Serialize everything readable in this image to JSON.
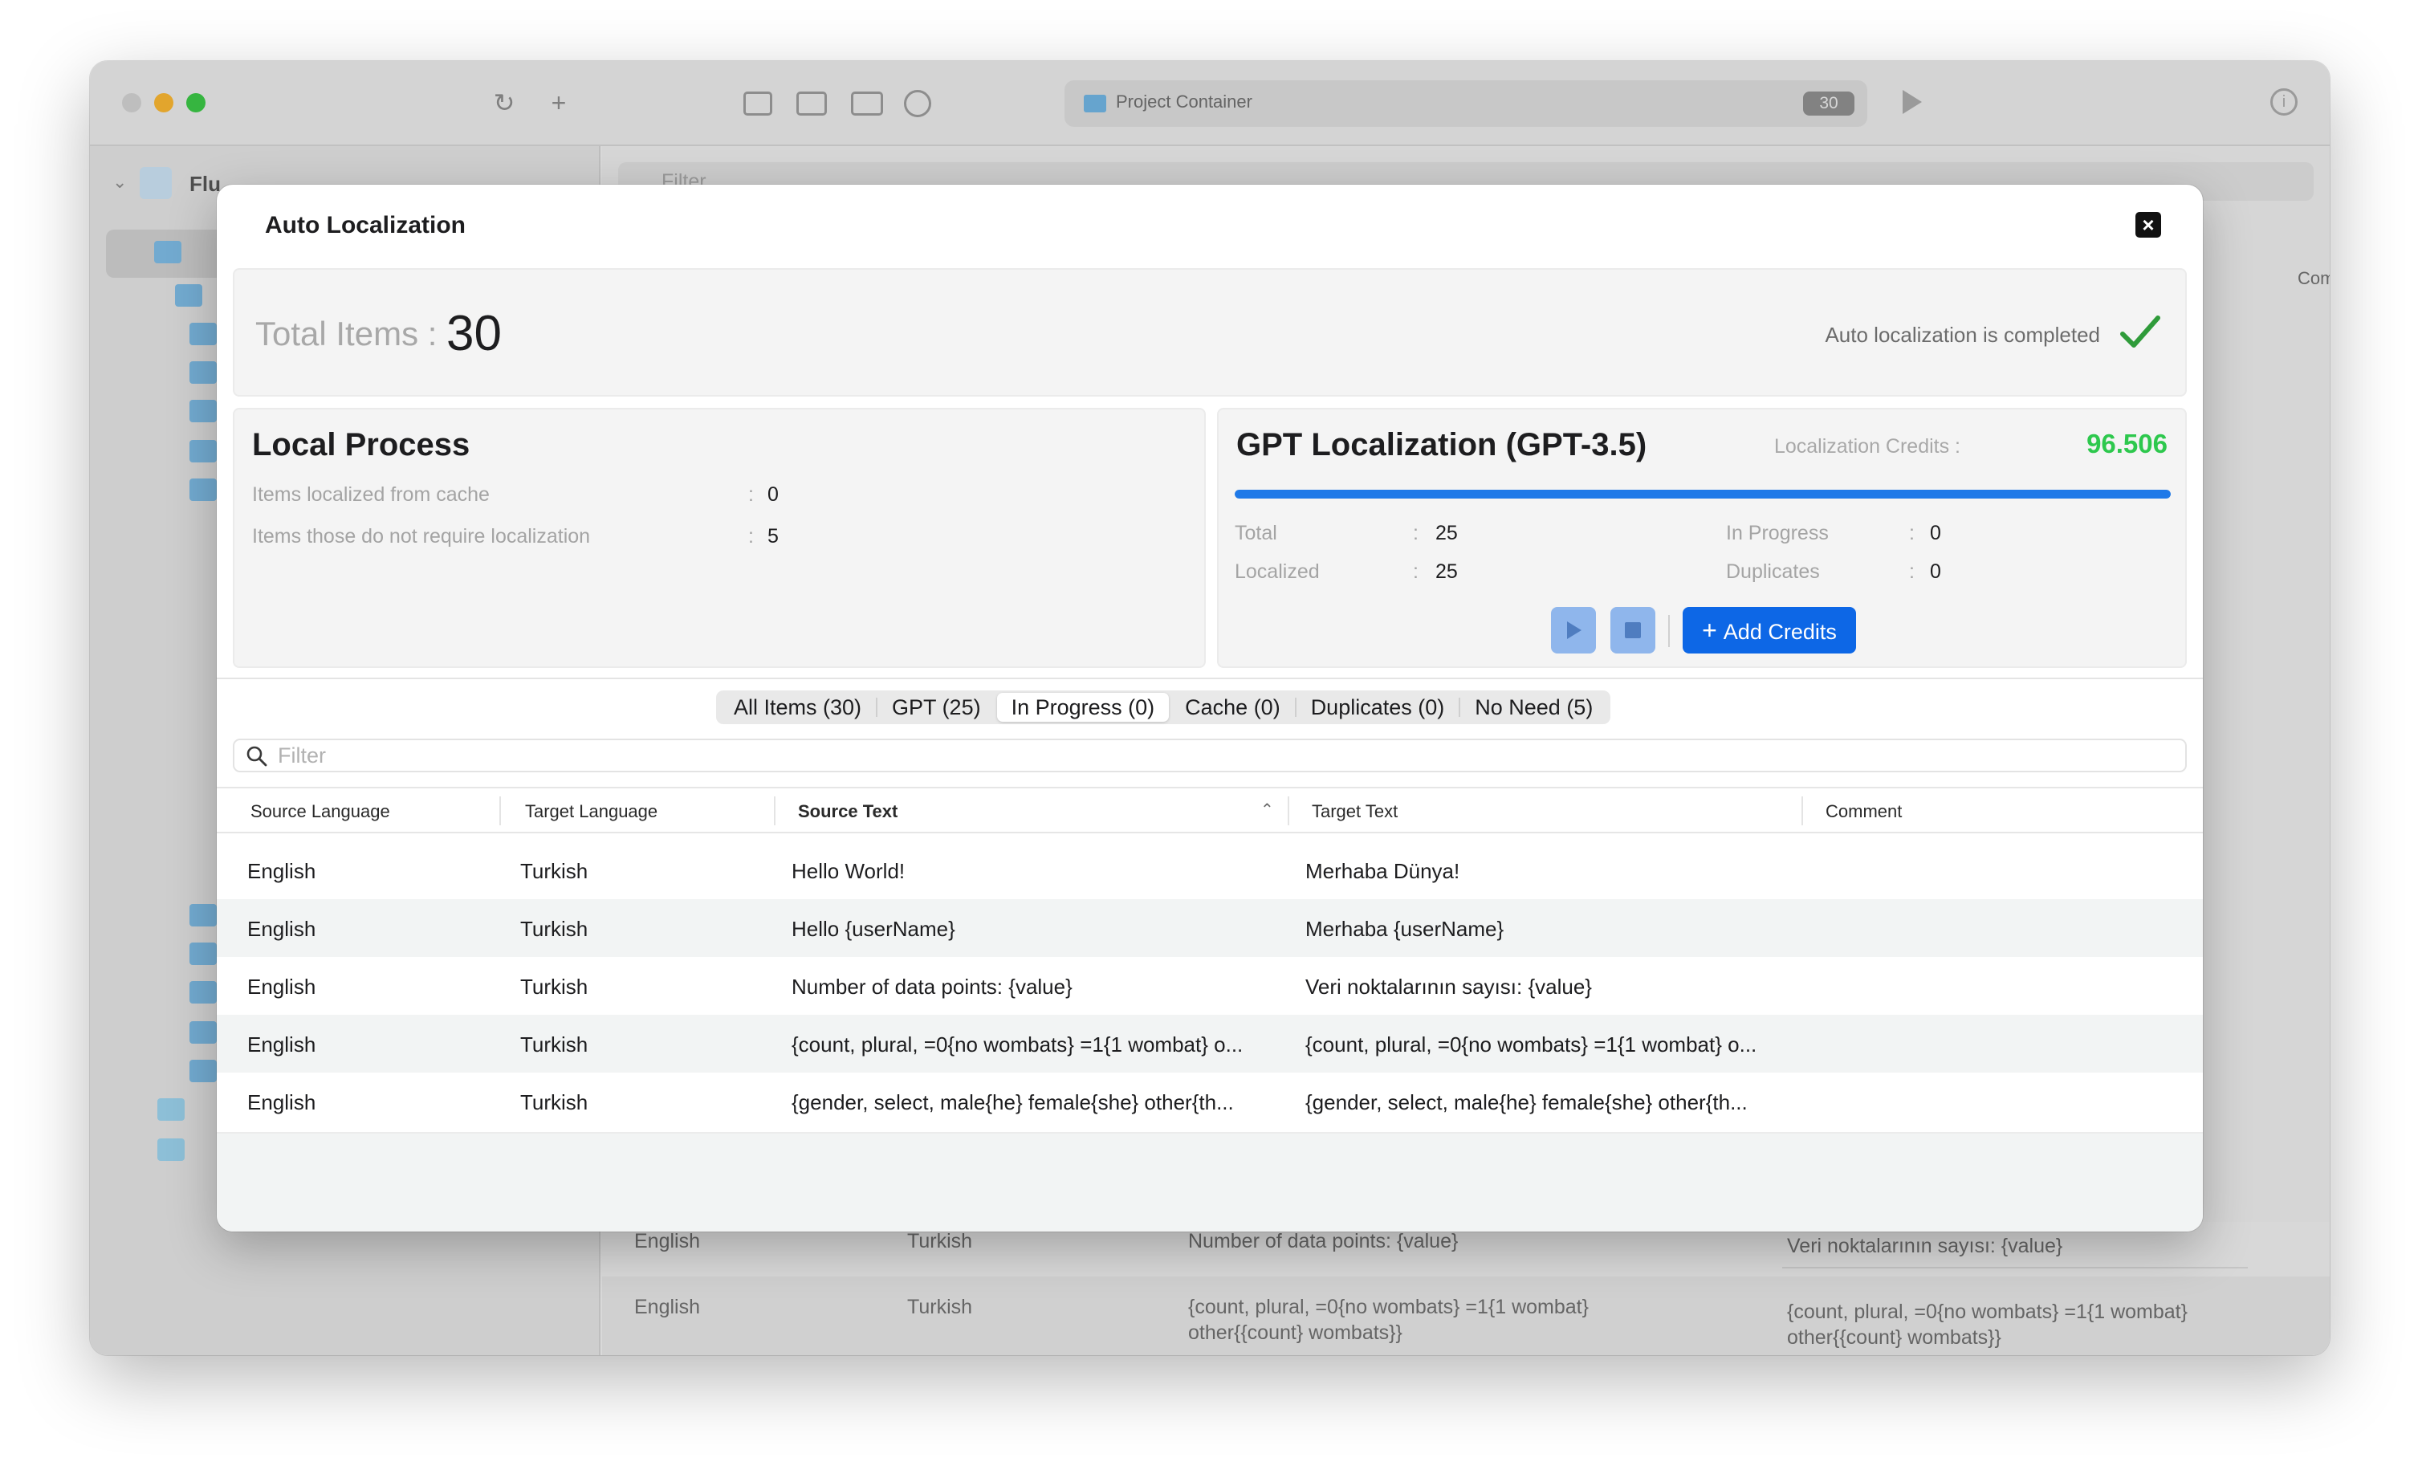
{
  "window": {
    "path_bar": {
      "label": "Project Container",
      "count": "30"
    },
    "sidebar_project": "Flu",
    "background_column_comment": "Comment",
    "background_filter_placeholder": "Filter",
    "background_rows": [
      {
        "source_language": "English",
        "target_language": "Turkish",
        "source_text": "Number of data points: {value}",
        "target_text": "Veri noktalarının sayısı: {value}"
      },
      {
        "source_language": "English",
        "target_language": "Turkish",
        "source_text_line1": "{count, plural, =0{no wombats} =1{1 wombat}",
        "source_text_line2": "other{{count} wombats}}",
        "target_text_line1": "{count, plural, =0{no wombats} =1{1 wombat}",
        "target_text_line2": "other{{count} wombats}}"
      }
    ]
  },
  "modal": {
    "title": "Auto Localization",
    "summary": {
      "total_label": "Total Items :",
      "total_value": "30",
      "status_text": "Auto localization is completed"
    },
    "local_process": {
      "title": "Local Process",
      "items": [
        {
          "label": "Items localized from cache",
          "value": "0"
        },
        {
          "label": "Items those do not require localization",
          "value": "5"
        }
      ]
    },
    "gpt": {
      "title": "GPT Localization (GPT-3.5)",
      "credits_label": "Localization Credits :",
      "credits_value": "96.506",
      "progress": 1.0,
      "stats_left": [
        {
          "label": "Total",
          "value": "25"
        },
        {
          "label": "Localized",
          "value": "25"
        }
      ],
      "stats_right": [
        {
          "label": "In Progress",
          "value": "0"
        },
        {
          "label": "Duplicates",
          "value": "0"
        }
      ],
      "add_credits_label": "Add Credits"
    },
    "tabs": [
      {
        "label": "All Items (30)",
        "active": false
      },
      {
        "label": "GPT (25)",
        "active": false
      },
      {
        "label": "In Progress (0)",
        "active": true
      },
      {
        "label": "Cache (0)",
        "active": false
      },
      {
        "label": "Duplicates (0)",
        "active": false
      },
      {
        "label": "No Need (5)",
        "active": false
      }
    ],
    "filter_placeholder": "Filter",
    "columns": [
      "Source Language",
      "Target Language",
      "Source Text",
      "Target Text",
      "Comment"
    ],
    "rows": [
      {
        "source_language": "English",
        "target_language": "Turkish",
        "source_text": "Hello World!",
        "target_text": "Merhaba Dünya!",
        "comment": ""
      },
      {
        "source_language": "English",
        "target_language": "Turkish",
        "source_text": "Hello {userName}",
        "target_text": "Merhaba {userName}",
        "comment": ""
      },
      {
        "source_language": "English",
        "target_language": "Turkish",
        "source_text": "Number of data points: {value}",
        "target_text": "Veri noktalarının sayısı: {value}",
        "comment": ""
      },
      {
        "source_language": "English",
        "target_language": "Turkish",
        "source_text": "{count, plural, =0{no wombats} =1{1 wombat} o...",
        "target_text": "{count, plural, =0{no wombats} =1{1 wombat} o...",
        "comment": ""
      },
      {
        "source_language": "English",
        "target_language": "Turkish",
        "source_text": "{gender, select, male{he} female{she} other{th...",
        "target_text": "{gender, select, male{he} female{she} other{th...",
        "comment": ""
      }
    ]
  },
  "colors": {
    "accent": "#0d67e6",
    "progress": "#1f79e8",
    "credits": "#2dc84d",
    "check": "#2f9b3a"
  }
}
